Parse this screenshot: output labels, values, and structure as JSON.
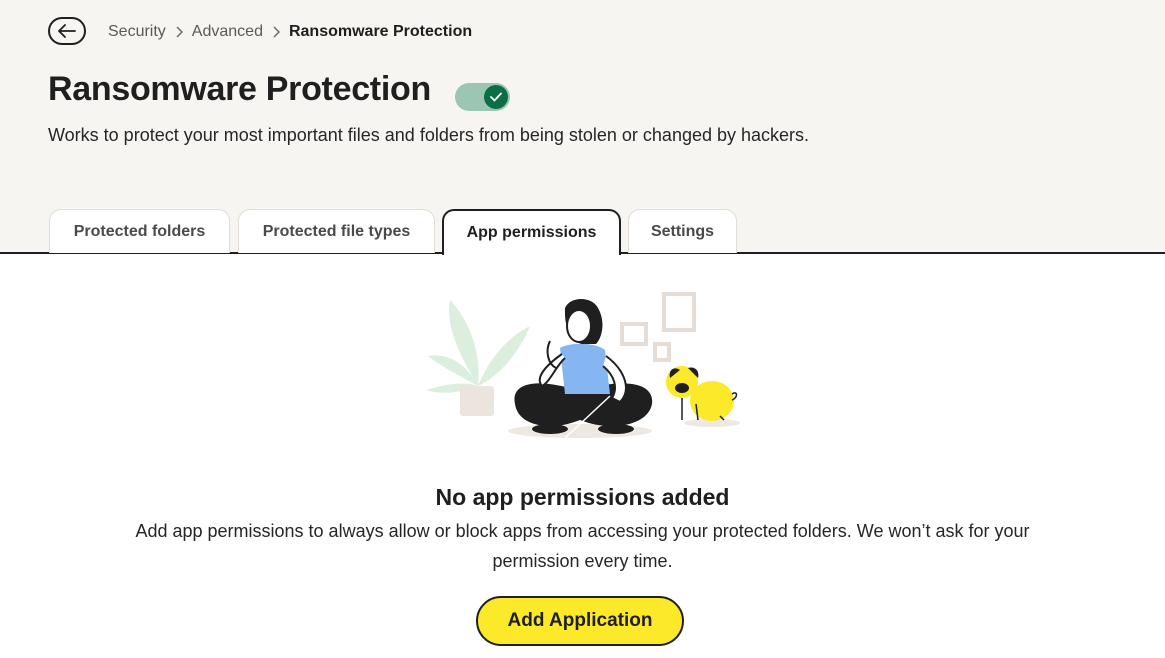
{
  "breadcrumb": {
    "items": [
      "Security",
      "Advanced"
    ],
    "current": "Ransomware Protection"
  },
  "page": {
    "title": "Ransomware Protection",
    "description": "Works to protect your most important files and folders from being stolen or changed by hackers.",
    "toggle_on": true
  },
  "tabs": [
    {
      "label": "Protected folders",
      "active": false
    },
    {
      "label": "Protected file types",
      "active": false
    },
    {
      "label": "App permissions",
      "active": true
    },
    {
      "label": "Settings",
      "active": false
    }
  ],
  "empty_state": {
    "title": "No app permissions added",
    "description": "Add app permissions to always allow or block apps from accessing your protected folders. We won’t ask for your permission every time.",
    "button_label": "Add Application"
  },
  "icons": {
    "back": "arrow-left-icon",
    "separator": "chevron-right-icon",
    "toggle": "check-icon"
  },
  "colors": {
    "header_bg": "#f7f5f2",
    "toggle_track": "#9cc5b3",
    "toggle_knob": "#0b6e45",
    "primary_button": "#fce92a"
  }
}
